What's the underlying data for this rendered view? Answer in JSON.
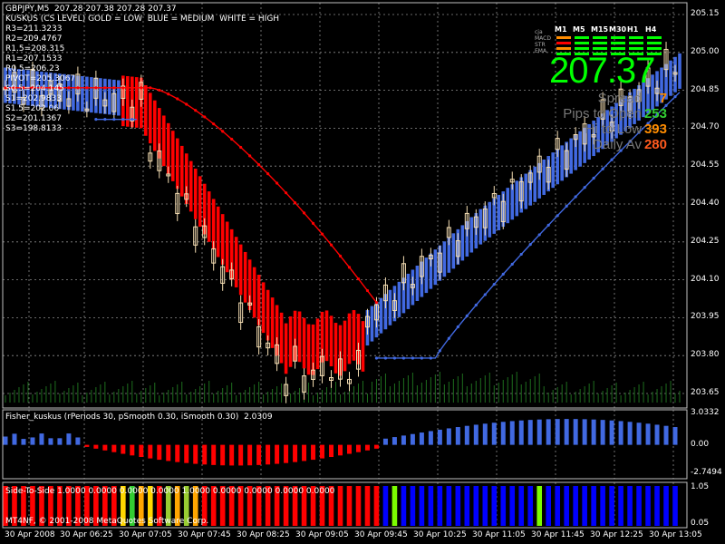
{
  "header": {
    "symbol_line": "GBPJPY,M5  207.28 207.38 207.28 207.37",
    "indicator_line": "KUSKUS (CS LEVEL) GOLD = LOW  BLUE = MEDIUM  WHITE = HIGH"
  },
  "pivots": [
    "R3=211.3233",
    "R2=209.4767",
    "R1.5=208.315",
    "R1=207.1533",
    "R0.5=206.23",
    "PIVOT=205.3067",
    "S0.5=204.145",
    "S1=202.9833",
    "S1.5=202.06",
    "S2=201.1367",
    "S3=198.8133"
  ],
  "panel": {
    "row_labels": [
      "cja",
      "MACD",
      "STR",
      "EMA"
    ],
    "timeframes": [
      "M1",
      "M5",
      "M15",
      "M30",
      "H1",
      "H4"
    ],
    "price": "207.37",
    "stats": [
      {
        "label": "Spread",
        "value": "7",
        "color": "#ff8c00"
      },
      {
        "label": "Pips to Open",
        "value": "253",
        "color": "#32cd32"
      },
      {
        "label": "Hi to Low",
        "value": "393",
        "color": "#ff8c00"
      },
      {
        "label": "Daily Av",
        "value": "280",
        "color": "#ff5a1e"
      }
    ]
  },
  "price_axis": [
    "205.15",
    "205.00",
    "204.85",
    "204.70",
    "204.55",
    "204.40",
    "204.25",
    "204.10",
    "203.95",
    "203.80",
    "203.65"
  ],
  "fisher": {
    "label": "Fisher_kuskus (rPeriods 30, pSmooth 0.30, iSmooth 0.30)  2.0309",
    "axis": [
      "3.0332",
      "0.00",
      "-2.7494"
    ]
  },
  "side": {
    "label": "Side-To-Side 1.0000 0.0000 0.0000 0.0000 1.0000 0.0000 0.0000 0.0000 0.0000",
    "copyright": "MT4NF, © 2001-2008 MetaQuotes Software Corp.",
    "axis": [
      "1.05",
      "0.05"
    ]
  },
  "time_axis": [
    "30 Apr 2008",
    "30 Apr 06:25",
    "30 Apr 07:05",
    "30 Apr 07:45",
    "30 Apr 08:25",
    "30 Apr 09:05",
    "30 Apr 09:45",
    "30 Apr 10:25",
    "30 Apr 11:05",
    "30 Apr 11:45",
    "30 Apr 12:25",
    "30 Apr 13:05"
  ],
  "colors": {
    "bull_band": "#4169e1",
    "bear_band": "#ff0000",
    "grid": "#8c8c8c",
    "candle": "#f5deb3",
    "volume": "#1e6e1e"
  }
}
